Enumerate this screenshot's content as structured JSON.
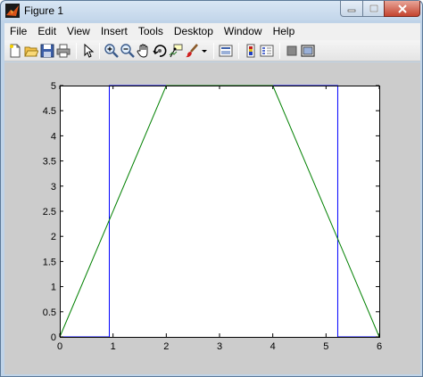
{
  "window": {
    "title": "Figure 1",
    "controls": {
      "minimize": "minimize",
      "maximize": "maximize",
      "close": "close"
    }
  },
  "menu": {
    "items": [
      "File",
      "Edit",
      "View",
      "Insert",
      "Tools",
      "Desktop",
      "Window",
      "Help"
    ]
  },
  "toolbar": {
    "buttons": [
      "new-figure-icon",
      "open-file-icon",
      "save-icon",
      "print-icon",
      "edit-plot-arrow-icon",
      "zoom-in-icon",
      "zoom-out-icon",
      "pan-hand-icon",
      "rotate-3d-icon",
      "data-cursor-icon",
      "brush-icon",
      "brush-dropdown-icon",
      "link-plot-icon",
      "colorbar-icon",
      "legend-icon",
      "hide-plot-tools-icon",
      "show-plot-tools-icon"
    ]
  },
  "colors": {
    "series_blue": "#0000ff",
    "series_green": "#008000",
    "figure_background": "#cccccc",
    "axes_background": "#ffffff"
  },
  "chart_data": {
    "type": "line",
    "title": "",
    "xlabel": "",
    "ylabel": "",
    "xlim": [
      0,
      6
    ],
    "ylim": [
      0,
      5
    ],
    "xticks": [
      "0",
      "1",
      "2",
      "3",
      "4",
      "5",
      "6"
    ],
    "yticks": [
      "0",
      "0.5",
      "1",
      "1.5",
      "2",
      "2.5",
      "3",
      "3.5",
      "4",
      "4.5",
      "5"
    ],
    "grid": false,
    "series": [
      {
        "color": "#0000ff",
        "x": [
          0,
          0.93,
          0.93,
          5.22,
          5.22,
          6
        ],
        "y": [
          0,
          0,
          5,
          5,
          0,
          0
        ]
      },
      {
        "color": "#008000",
        "x": [
          0,
          2,
          4,
          6
        ],
        "y": [
          0,
          5,
          5,
          0
        ]
      }
    ]
  }
}
